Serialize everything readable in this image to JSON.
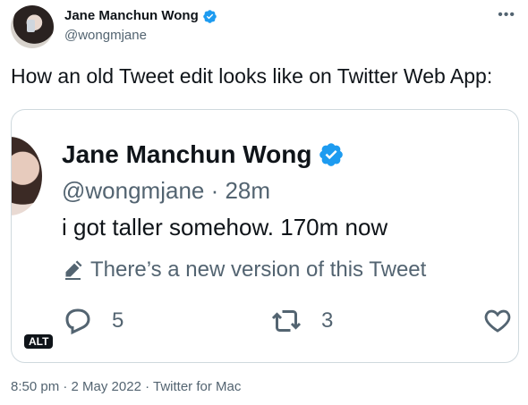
{
  "author": {
    "name": "Jane Manchun Wong",
    "handle": "@wongmjane",
    "verified": true
  },
  "tweet": {
    "text": "How an old Tweet edit looks like on Twitter Web App:"
  },
  "media": {
    "snippet": {
      "name": "Jane Manchun Wong",
      "handle_time": "@wongmjane · 28m",
      "text": "i got taller somehow. 170m now",
      "edit_notice": "There’s a new version of this Tweet",
      "reply_count": "5",
      "retweet_count": "3"
    },
    "alt_label": "ALT"
  },
  "meta": {
    "time": "8:50 pm",
    "date": "2 May 2022",
    "source": "Twitter for Mac",
    "separator": " · "
  },
  "colors": {
    "accent": "#1d9bf0",
    "muted": "#536471",
    "text": "#0f1419",
    "border": "#cfd9de"
  },
  "icons": [
    "verified-badge-icon",
    "more-options-icon",
    "pencil-icon",
    "reply-icon",
    "retweet-icon",
    "like-icon"
  ]
}
